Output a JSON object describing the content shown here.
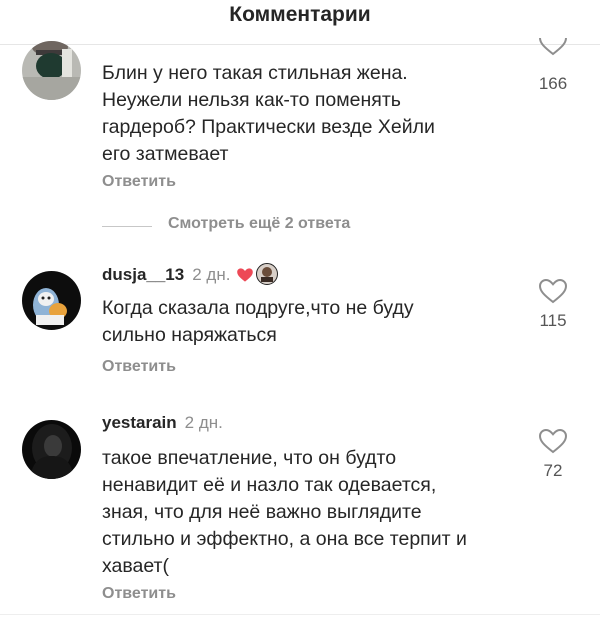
{
  "header": {
    "title": "Комментарии"
  },
  "comments": [
    {
      "username": "",
      "time": "",
      "lines": [
        "Блин у него такая стильная жена.",
        "Неужели нельзя как-то поменять",
        "гардероб? Практически везде Хейли",
        "его затмевает"
      ],
      "likes": "166",
      "reply_label": "Ответить",
      "view_more": "Смотреть ещё 2 ответа"
    },
    {
      "username": "dusja__13",
      "time": "2 дн.",
      "liked_by_author": true,
      "lines": [
        "Когда сказала подруге,что не буду",
        "сильно наряжаться"
      ],
      "likes": "115",
      "reply_label": "Ответить"
    },
    {
      "username": "yestarain",
      "time": "2 дн.",
      "lines": [
        "такое впечатление, что он будто",
        "ненавидит её и назло так одевается,",
        "зная, что для неё важно выглядите",
        "стильно и эффектно, а она все терпит и",
        "хавает("
      ],
      "likes": "72",
      "reply_label": "Ответить"
    }
  ],
  "icons": {
    "like": "heart-outline-icon",
    "author_like": "heart-filled-icon",
    "author_like_color": "#ed4956"
  }
}
